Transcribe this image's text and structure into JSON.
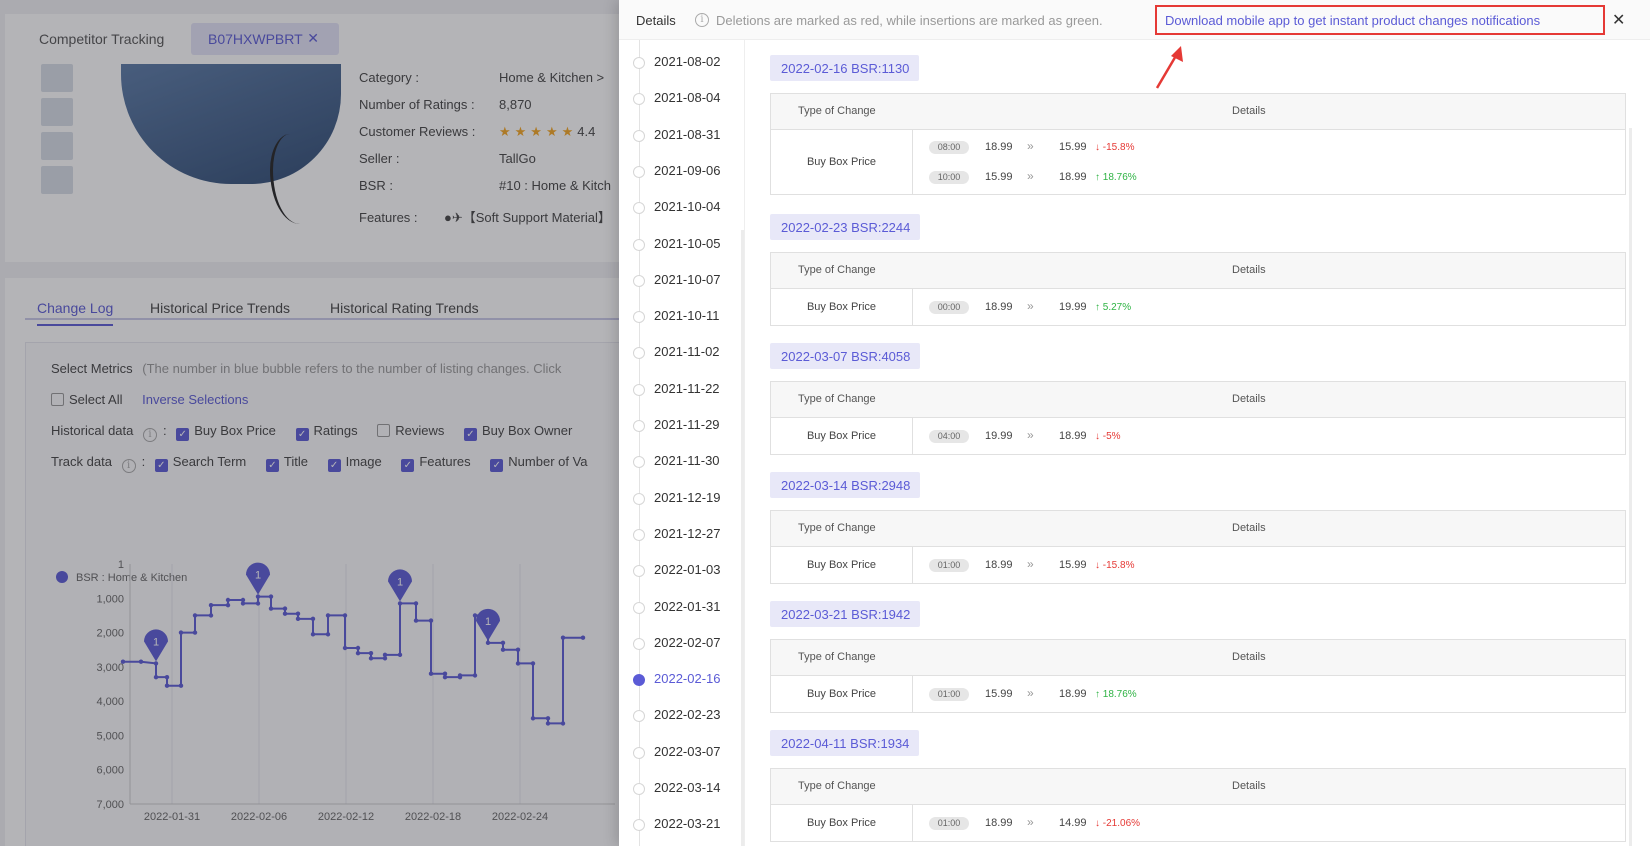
{
  "background": {
    "tab_label": "Competitor Tracking",
    "asin": "B07HXWPBRT",
    "product": {
      "category_label": "Category :",
      "category_value": "Home & Kitchen >",
      "ratings_label": "Number of Ratings :",
      "ratings_value": "8,870",
      "reviews_label": "Customer Reviews :",
      "reviews_value": "4.4",
      "seller_label": "Seller :",
      "seller_value": "TallGo",
      "bsr_label": "BSR :",
      "bsr_value": "#10 : Home & Kitch",
      "features_label": "Features :",
      "features_value": "●✈【Soft Support Material】"
    },
    "tabs": [
      "Change Log",
      "Historical Price Trends",
      "Historical Rating Trends"
    ],
    "metrics": {
      "select_label": "Select Metrics",
      "select_hint": "(The number in blue bubble refers to the number of listing changes. Click",
      "select_all": "Select All",
      "inverse": "Inverse Selections",
      "historical_label": "Historical data",
      "historical_items": [
        {
          "label": "Buy Box Price",
          "checked": true
        },
        {
          "label": "Ratings",
          "checked": true
        },
        {
          "label": "Reviews",
          "checked": false
        },
        {
          "label": "Buy Box Owner",
          "checked": true
        }
      ],
      "track_label": "Track data",
      "track_items": [
        {
          "label": "Search Term",
          "checked": true
        },
        {
          "label": "Title",
          "checked": true
        },
        {
          "label": "Image",
          "checked": true
        },
        {
          "label": "Features",
          "checked": true
        },
        {
          "label": "Number of Va",
          "checked": true
        }
      ]
    },
    "chart_legend": "BSR : Home & Kitchen",
    "chart_data": {
      "type": "line",
      "title": "",
      "series": [
        {
          "name": "BSR : Home & Kitchen"
        }
      ],
      "y_ticks": [
        "1",
        "1,000",
        "2,000",
        "3,000",
        "4,000",
        "5,000",
        "6,000",
        "7,000"
      ],
      "ylim": [
        1,
        7000
      ],
      "y_reversed": true,
      "x_ticks": [
        "2022-01-31",
        "2022-02-06",
        "2022-02-12",
        "2022-02-18",
        "2022-02-24"
      ],
      "bubbles": [
        "1",
        "1",
        "1",
        "1"
      ]
    }
  },
  "drawer": {
    "title": "Details",
    "note": "Deletions are marked as red, while insertions are marked as green.",
    "app_link": "Download mobile app to get instant product changes notifications",
    "close": "✕",
    "timeline": [
      "2021-08-02",
      "2021-08-04",
      "2021-08-31",
      "2021-09-06",
      "2021-10-04",
      "2021-10-05",
      "2021-10-07",
      "2021-10-11",
      "2021-11-02",
      "2021-11-22",
      "2021-11-29",
      "2021-11-30",
      "2021-12-19",
      "2021-12-27",
      "2022-01-03",
      "2022-01-31",
      "2022-02-07",
      "2022-02-16",
      "2022-02-23",
      "2022-03-07",
      "2022-03-14",
      "2022-03-21"
    ],
    "active_date": "2022-02-16",
    "table_headers": {
      "type": "Type of Change",
      "details": "Details"
    },
    "sections": [
      {
        "header": "2022-02-16 BSR:1130",
        "type": "Buy Box Price",
        "changes": [
          {
            "time": "08:00",
            "from": "18.99",
            "to": "15.99",
            "pct": "-15.8%",
            "dir": "down"
          },
          {
            "time": "10:00",
            "from": "15.99",
            "to": "18.99",
            "pct": "18.76%",
            "dir": "up"
          }
        ]
      },
      {
        "header": "2022-02-23 BSR:2244",
        "type": "Buy Box Price",
        "changes": [
          {
            "time": "00:00",
            "from": "18.99",
            "to": "19.99",
            "pct": "5.27%",
            "dir": "up"
          }
        ]
      },
      {
        "header": "2022-03-07 BSR:4058",
        "type": "Buy Box Price",
        "changes": [
          {
            "time": "04:00",
            "from": "19.99",
            "to": "18.99",
            "pct": "-5%",
            "dir": "down"
          }
        ]
      },
      {
        "header": "2022-03-14 BSR:2948",
        "type": "Buy Box Price",
        "changes": [
          {
            "time": "01:00",
            "from": "18.99",
            "to": "15.99",
            "pct": "-15.8%",
            "dir": "down"
          }
        ]
      },
      {
        "header": "2022-03-21 BSR:1942",
        "type": "Buy Box Price",
        "changes": [
          {
            "time": "01:00",
            "from": "15.99",
            "to": "18.99",
            "pct": "18.76%",
            "dir": "up"
          }
        ]
      },
      {
        "header": "2022-04-11 BSR:1934",
        "type": "Buy Box Price",
        "changes": [
          {
            "time": "01:00",
            "from": "18.99",
            "to": "14.99",
            "pct": "-21.06%",
            "dir": "down"
          }
        ]
      }
    ],
    "icons": {
      "info": "info-circle-icon",
      "close": "close-icon",
      "up": "arrow-up-icon",
      "down": "arrow-down-icon",
      "sep": "double-chevron-right-icon"
    },
    "colors": {
      "accent": "#5b5bd6",
      "up": "#2fb344",
      "down": "#e53935",
      "highlight": "#e53935"
    }
  }
}
